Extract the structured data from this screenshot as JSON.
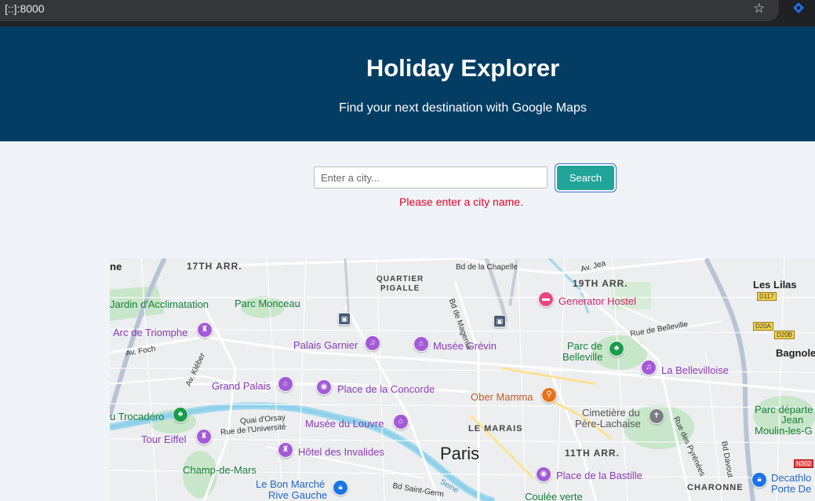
{
  "browser": {
    "url": "[::]:8000"
  },
  "header": {
    "title": "Holiday Explorer",
    "subtitle": "Find your next destination with Google Maps"
  },
  "search": {
    "placeholder": "Enter a city...",
    "value": "",
    "button_label": "Search",
    "error": "Please enter a city name."
  },
  "map": {
    "districts": [
      "17TH ARR.",
      "QUARTIER",
      "PIGALLE",
      "19TH ARR.",
      "LE MARAIS",
      "11TH ARR.",
      "CHARONNE"
    ],
    "city": "Paris",
    "towns": [
      "Les Lilas",
      "Bagnole",
      "ne"
    ],
    "pois": {
      "jardin": "Jardin d'Acclimatation",
      "monceau": "Parc Monceau",
      "generator": "Generator Hostel",
      "arc": "Arc de Triomphe",
      "garnier": "Palais Garnier",
      "grevin": "Musée Grévin",
      "belleville": "Parc de",
      "belleville2": "Belleville",
      "bellevilloise": "La Bellevilloise",
      "grand_palais": "Grand Palais",
      "concorde": "Place de la Concorde",
      "obermamma": "Ober Mamma",
      "trocadero": "u Trocadéro",
      "cimetiere": "Cimetière du",
      "cimetiere2": "Père-Lachaise",
      "parc_dept": "Parc départe",
      "parc_dept2": "Jean",
      "parc_dept3": "Moulin-les-G",
      "eiffel": "Tour Eiffel",
      "louvre": "Musée du Louvre",
      "invalides": "Hôtel des Invalides",
      "champ": "Champ-de-Mars",
      "bonmarche": "Le Bon Marché",
      "bonmarche2": "Rive Gauche",
      "bastille": "Place de la Bastille",
      "coulee": "Coulée verte",
      "decathlon": "Decathlo",
      "decathlon2": "Porte De"
    },
    "streets": {
      "chapelle": "Bd de la Chapelle",
      "magenta": "Bd de Magenta",
      "foch": "Av. Foch",
      "kleber": "Av. Kléber",
      "belleville_rue": "Rue de Belleville",
      "orsay": "Quai d'Orsay",
      "universite": "Rue de l'Université",
      "pyrenees": "Rue des Pyrénées",
      "davout": "Bd Davout",
      "saint_germain": "Bd Saint-Germ",
      "seine": "Seine",
      "av_jean": "Av. Jea"
    },
    "road_signs": [
      "D117",
      "D20A",
      "D20B",
      "N302"
    ]
  },
  "colors": {
    "header_bg": "#033d63",
    "button_bg": "#21a49a",
    "error": "#e8002a",
    "page_bg": "#f0f3f7"
  }
}
